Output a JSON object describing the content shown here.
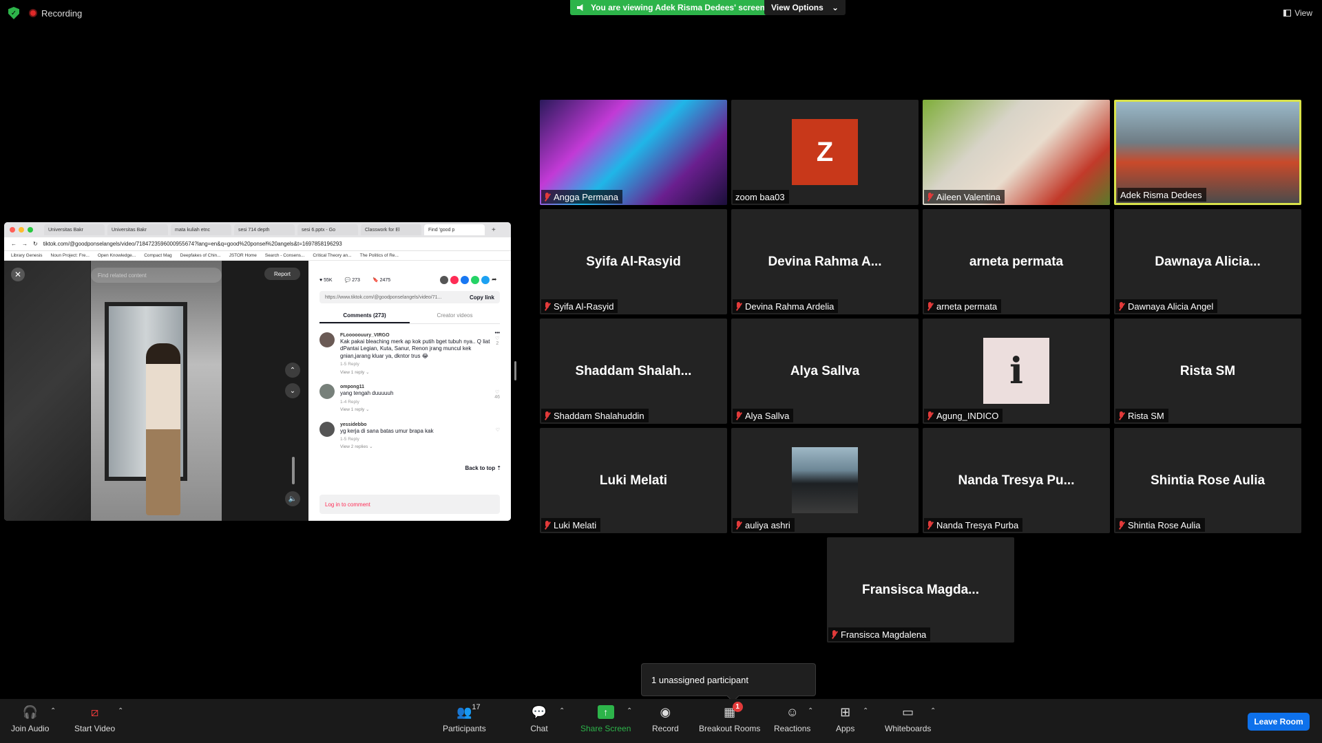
{
  "top": {
    "recording_label": "Recording",
    "viewing_banner": "You are viewing Adek Risma Dedees' screen",
    "view_options": "View Options",
    "view_label": "View"
  },
  "shared_screen": {
    "browser": {
      "tabs": [
        "Universitas Bakr",
        "Universitas Bakr",
        "mata kuliah etnc",
        "sesi 714 depth",
        "sesi 6.pptx - Go",
        "Classwork for El",
        "Find 'good p"
      ],
      "url": "tiktok.com/@goodponselangels/video/7184723596000955674?lang=en&q=good%20ponsel%20angels&t=1697858196293",
      "bookmarks": [
        "Library Genesis",
        "Noun Project: Fre...",
        "Open Knowledge...",
        "Compact Mag",
        "Deepfakes of Chin...",
        "JSTOR Home",
        "Search - Consens...",
        "Critical Theory an...",
        "The Politics of Re..."
      ]
    },
    "tiktok": {
      "search_placeholder": "Find related content",
      "report": "Report",
      "likes": "55K",
      "comments_count": "273",
      "saves": "2475",
      "link": "https://www.tiktok.com/@goodponselangels/video/71...",
      "copy_link": "Copy link",
      "tab_comments": "Comments (273)",
      "tab_creator": "Creator videos",
      "comments": [
        {
          "user": "FLooooouury_VIRGO",
          "text": "Kak pakai bleaching merk ap kok putih bget tubuh nya.. Q liat dPantai Legian, Kuta, Sanur, Renon jrang muncul kek gnian,jarang kluar ya, dkntor trus 😂",
          "meta": "1-5      Reply",
          "more": "View 1 reply ⌄",
          "likes": "2"
        },
        {
          "user": "ompong11",
          "text": "yang tengah duuuuuh",
          "meta": "1-4      Reply",
          "more": "View 1 reply ⌄",
          "likes": "46"
        },
        {
          "user": "yessidebbo",
          "text": "yg kerja di sana batas umur brapa kak",
          "meta": "1-5      Reply",
          "more": "View 2 replies ⌄",
          "likes": ""
        }
      ],
      "back_to_top": "Back to top ⇡",
      "login": "Log in to comment"
    }
  },
  "participants": [
    {
      "name": "Angga Permana",
      "type": "video"
    },
    {
      "name": "zoom baa03",
      "type": "initial",
      "initial": "Z"
    },
    {
      "name": "Aileen Valentina",
      "type": "video"
    },
    {
      "name": "Adek Risma Dedees",
      "type": "video",
      "active": true
    },
    {
      "name": "Syifa Al-Rasyid",
      "big": "Syifa Al-Rasyid"
    },
    {
      "name": "Devina Rahma Ardelia",
      "big": "Devina Rahma A..."
    },
    {
      "name": "arneta permata",
      "big": "arneta permata"
    },
    {
      "name": "Dawnaya Alicia Angel",
      "big": "Dawnaya Alicia..."
    },
    {
      "name": "Shaddam Shalahuddin",
      "big": "Shaddam Shalah..."
    },
    {
      "name": "Alya Sallva",
      "big": "Alya Sallva"
    },
    {
      "name": "Agung_INDICO",
      "type": "info"
    },
    {
      "name": "Rista SM",
      "big": "Rista SM"
    },
    {
      "name": "Luki Melati",
      "big": "Luki Melati"
    },
    {
      "name": "auliya ashri",
      "type": "photo"
    },
    {
      "name": "Nanda Tresya Purba",
      "big": "Nanda Tresya Pu..."
    },
    {
      "name": "Shintia Rose Aulia",
      "big": "Shintia Rose Aulia"
    },
    {
      "name": "Fransisca Magdalena",
      "big": "Fransisca Magda..."
    }
  ],
  "tooltip": "1 unassigned participant",
  "toolbar": {
    "join_audio": "Join Audio",
    "start_video": "Start Video",
    "participants": "Participants",
    "participants_count": "17",
    "chat": "Chat",
    "share_screen": "Share Screen",
    "record": "Record",
    "breakout_rooms": "Breakout Rooms",
    "breakout_badge": "1",
    "reactions": "Reactions",
    "apps": "Apps",
    "whiteboards": "Whiteboards",
    "leave_room": "Leave Room"
  },
  "colors": {
    "accent_green": "#2db44a",
    "leave_blue": "#0e71eb",
    "active_border": "#d9e34b",
    "mute_red": "#e23a3a"
  }
}
